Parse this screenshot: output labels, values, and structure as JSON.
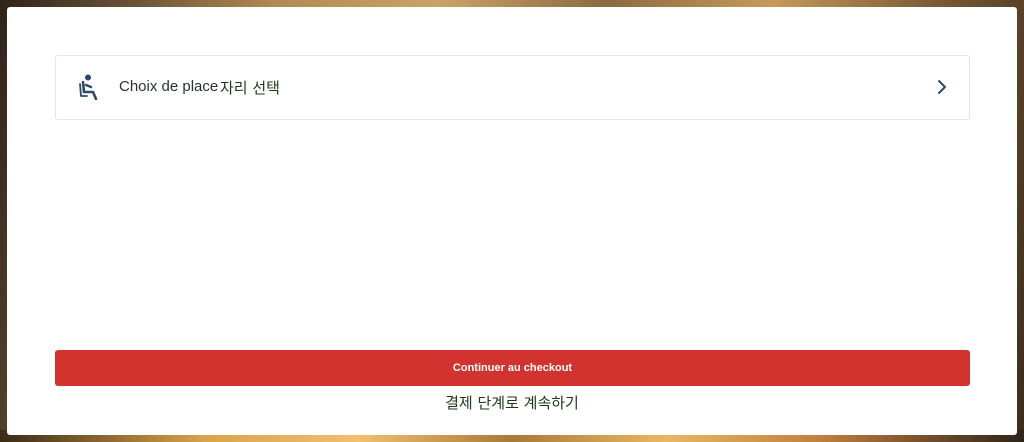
{
  "seat_selection": {
    "label": "Choix de place",
    "label_translation": "자리 선택",
    "icon": "seat-person-icon",
    "chevron_icon": "chevron-right-icon"
  },
  "checkout": {
    "button_label": "Continuer au checkout",
    "button_translation": "결제 단계로 계속하기"
  },
  "colors": {
    "accent_red": "#d2332f",
    "icon_blue": "#2b4a6e",
    "card_border": "#e2e5e9"
  }
}
